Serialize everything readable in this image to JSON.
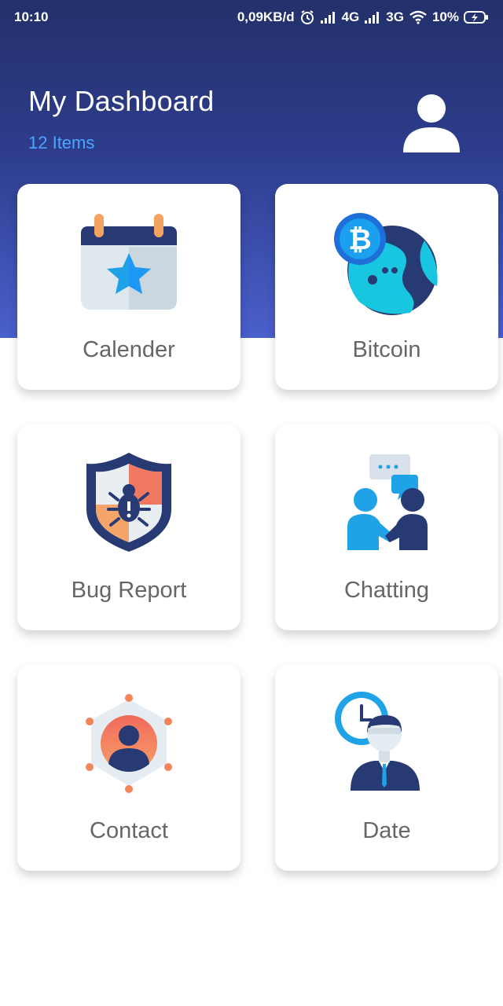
{
  "status_bar": {
    "time": "10:10",
    "net_speed": "0,09KB/d",
    "network1": "4G",
    "network2": "3G",
    "battery": "10%"
  },
  "header": {
    "title": "My Dashboard",
    "subtitle": "12 Items"
  },
  "cards": [
    {
      "label": "Calender",
      "icon": "calendar-star-icon"
    },
    {
      "label": "Bitcoin",
      "icon": "bitcoin-globe-icon"
    },
    {
      "label": "Bug Report",
      "icon": "bug-shield-icon"
    },
    {
      "label": "Chatting",
      "icon": "chatting-people-icon"
    },
    {
      "label": "Contact",
      "icon": "contact-hexagon-icon"
    },
    {
      "label": "Date",
      "icon": "clock-businessman-icon"
    }
  ],
  "colors": {
    "header_top": "#23306a",
    "header_bottom": "#4a60cc",
    "subtitle": "#4aa6ff",
    "card_label": "#666666"
  }
}
